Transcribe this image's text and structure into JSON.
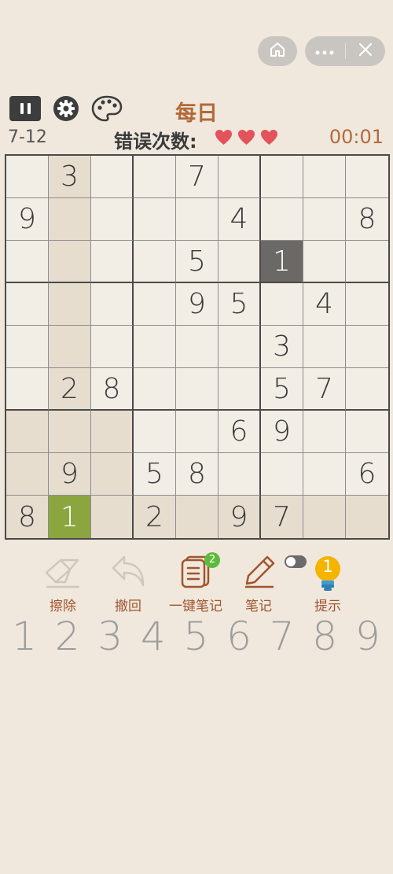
{
  "mode_title": "每日",
  "level": "7-12",
  "mistakes_label": "错误次数:",
  "hearts": 3,
  "timer": "00:01",
  "colors": {
    "accent": "#b26a3a",
    "heart": "#e4525b",
    "cell_highlight": "#e6ddcf",
    "cell_selected": "#6a6966",
    "cell_current": "#8ba63f",
    "badge": "#5dbb3c",
    "hint": "#f4b400"
  },
  "board": [
    [
      "",
      "3",
      "",
      "",
      "7",
      "",
      "",
      "",
      ""
    ],
    [
      "9",
      "",
      "",
      "",
      "",
      "4",
      "",
      "",
      "8"
    ],
    [
      "",
      "",
      "",
      "",
      "5",
      "",
      "1",
      "",
      ""
    ],
    [
      "",
      "",
      "",
      "",
      "9",
      "5",
      "",
      "4",
      ""
    ],
    [
      "",
      "",
      "",
      "",
      "",
      "",
      "3",
      "",
      ""
    ],
    [
      "",
      "2",
      "8",
      "",
      "",
      "",
      "5",
      "7",
      ""
    ],
    [
      "",
      "",
      "",
      "",
      "",
      "6",
      "9",
      "",
      ""
    ],
    [
      "",
      "9",
      "",
      "5",
      "8",
      "",
      "",
      "",
      "6"
    ],
    [
      "8",
      "1",
      "",
      "2",
      "",
      "9",
      "7",
      "",
      ""
    ]
  ],
  "highlighted_cells": [
    [
      0,
      1
    ],
    [
      1,
      1
    ],
    [
      2,
      1
    ],
    [
      3,
      1
    ],
    [
      4,
      1
    ],
    [
      5,
      1
    ],
    [
      6,
      0
    ],
    [
      6,
      1
    ],
    [
      6,
      2
    ],
    [
      7,
      0
    ],
    [
      7,
      1
    ],
    [
      7,
      2
    ],
    [
      8,
      0
    ],
    [
      8,
      2
    ],
    [
      8,
      3
    ],
    [
      8,
      4
    ],
    [
      8,
      5
    ],
    [
      8,
      6
    ],
    [
      8,
      7
    ],
    [
      8,
      8
    ]
  ],
  "selected_cell": [
    2,
    6
  ],
  "current_cell": [
    8,
    1
  ],
  "tools": [
    {
      "label": "擦除",
      "icon": "eraser-icon"
    },
    {
      "label": "撤回",
      "icon": "undo-icon"
    },
    {
      "label": "一键笔记",
      "icon": "notes-list-icon",
      "badge": "2"
    },
    {
      "label": "笔记",
      "icon": "pencil-icon",
      "toggle": false
    },
    {
      "label": "提示",
      "icon": "lightbulb-icon",
      "count": "1"
    }
  ],
  "numpad": [
    "1",
    "2",
    "3",
    "4",
    "5",
    "6",
    "7",
    "8",
    "9"
  ]
}
